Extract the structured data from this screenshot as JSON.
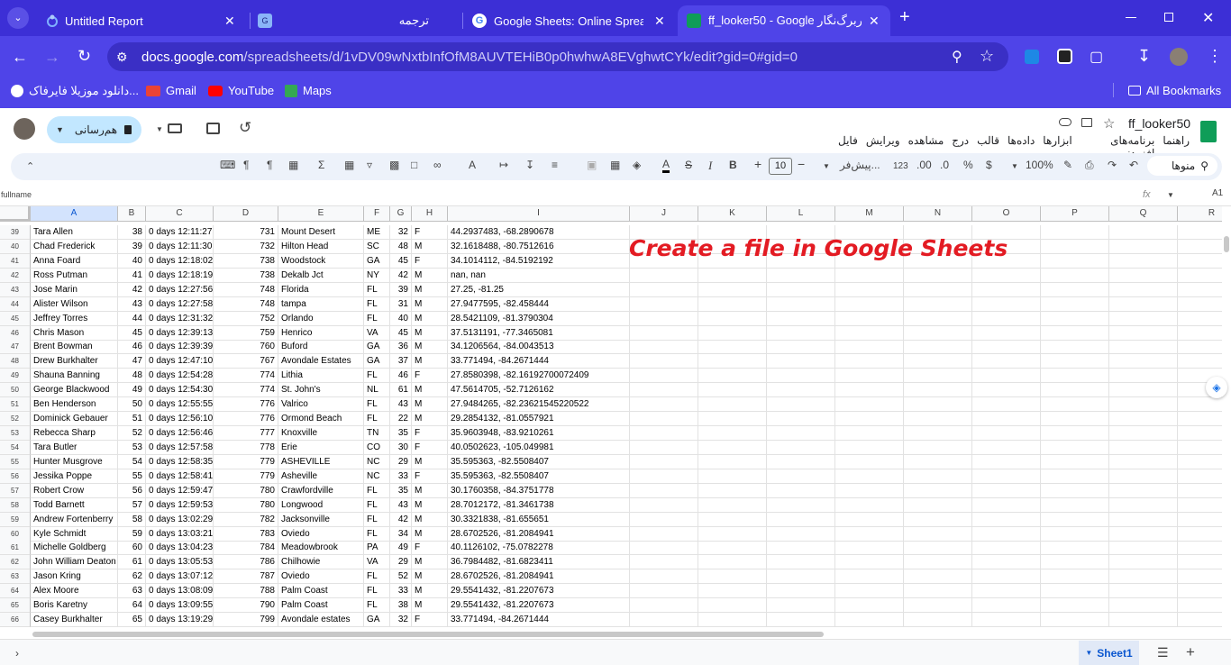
{
  "browser": {
    "tabs": [
      {
        "title": "Untitled Report",
        "active": false
      },
      {
        "title": "ترجمه",
        "active": false
      },
      {
        "title": "Google Sheets: Online Spreadsheets",
        "active": false
      },
      {
        "title": "ff_looker50 - Google کاربرگ‌نگار",
        "active": true
      }
    ],
    "new_tab_symbol": "+",
    "url_host": "docs.google.com",
    "url_path": "/spreadsheets/d/1vDV09wNxtbInfOfM8AUVTEHiB0p0hwhwA8EVghwtCYk/edit?gid=0#gid=0",
    "bookmarks": [
      {
        "label": "دانلود موزیلا فایرفاک...",
        "icon": "mozilla-icon"
      },
      {
        "label": "Gmail",
        "icon": "gmail-icon"
      },
      {
        "label": "YouTube",
        "icon": "youtube-icon"
      },
      {
        "label": "Maps",
        "icon": "maps-icon"
      }
    ],
    "all_bookmarks": "All Bookmarks"
  },
  "sheets": {
    "doc_title": "ff_looker50",
    "share_label": "هم‌رسانی",
    "menus": [
      "فایل",
      "ویرایش",
      "مشاهده",
      "درج",
      "قالب",
      "داده‌ها",
      "ابزارها",
      "برنامه‌های افزودنی",
      "راهنما"
    ],
    "toolbar": {
      "search_menus": "منوها",
      "zoom": "100%",
      "currency": "$",
      "percent": "%",
      "dec_decrease": ".0",
      "dec_increase": ".00",
      "format_123": "123",
      "font": "پیش‌فر...",
      "font_size": "10",
      "minus": "−",
      "plus": "+",
      "bold": "B",
      "italic": "I",
      "strike": "S",
      "text_color": "A",
      "sigma": "Σ"
    },
    "name_box": "A1",
    "formula_value": "fullname",
    "fx": "fx",
    "columns": [
      "A",
      "B",
      "C",
      "D",
      "E",
      "F",
      "G",
      "H",
      "I",
      "J",
      "K",
      "L",
      "M",
      "N",
      "O",
      "P",
      "Q",
      "R"
    ],
    "rows": [
      {
        "n": "39",
        "a": "Tara Allen",
        "b": "38",
        "c": "0 days 12:11:27",
        "d": "731",
        "e": "Mount Desert",
        "f": "ME",
        "g": "32",
        "h": "F",
        "i": "44.2937483, -68.2890678"
      },
      {
        "n": "40",
        "a": "Chad Frederick",
        "b": "39",
        "c": "0 days 12:11:30",
        "d": "732",
        "e": "Hilton Head",
        "f": "SC",
        "g": "48",
        "h": "M",
        "i": "32.1618488, -80.7512616"
      },
      {
        "n": "41",
        "a": "Anna Foard",
        "b": "40",
        "c": "0 days 12:18:02",
        "d": "738",
        "e": "Woodstock",
        "f": "GA",
        "g": "45",
        "h": "F",
        "i": "34.1014112, -84.5192192"
      },
      {
        "n": "42",
        "a": "Ross Putman",
        "b": "41",
        "c": "0 days 12:18:19",
        "d": "738",
        "e": "Dekalb Jct",
        "f": "NY",
        "g": "42",
        "h": "M",
        "i": "nan, nan"
      },
      {
        "n": "43",
        "a": "Jose Marin",
        "b": "42",
        "c": "0 days 12:27:56",
        "d": "748",
        "e": "Florida",
        "f": "FL",
        "g": "39",
        "h": "M",
        "i": "27.25, -81.25"
      },
      {
        "n": "44",
        "a": "Alister Wilson",
        "b": "43",
        "c": "0 days 12:27:58",
        "d": "748",
        "e": "tampa",
        "f": "FL",
        "g": "31",
        "h": "M",
        "i": "27.9477595, -82.458444"
      },
      {
        "n": "45",
        "a": "Jeffrey Torres",
        "b": "44",
        "c": "0 days 12:31:32",
        "d": "752",
        "e": "Orlando",
        "f": "FL",
        "g": "40",
        "h": "M",
        "i": "28.5421109, -81.3790304"
      },
      {
        "n": "46",
        "a": "Chris Mason",
        "b": "45",
        "c": "0 days 12:39:13",
        "d": "759",
        "e": "Henrico",
        "f": "VA",
        "g": "45",
        "h": "M",
        "i": "37.5131191, -77.3465081"
      },
      {
        "n": "47",
        "a": "Brent Bowman",
        "b": "46",
        "c": "0 days 12:39:39",
        "d": "760",
        "e": "Buford",
        "f": "GA",
        "g": "36",
        "h": "M",
        "i": "34.1206564, -84.0043513"
      },
      {
        "n": "48",
        "a": "Drew Burkhalter",
        "b": "47",
        "c": "0 days 12:47:10",
        "d": "767",
        "e": "Avondale Estates",
        "f": "GA",
        "g": "37",
        "h": "M",
        "i": "33.771494, -84.2671444"
      },
      {
        "n": "49",
        "a": "Shauna Banning",
        "b": "48",
        "c": "0 days 12:54:28",
        "d": "774",
        "e": "Lithia",
        "f": "FL",
        "g": "46",
        "h": "F",
        "i": "27.8580398, -82.16192700072409"
      },
      {
        "n": "50",
        "a": "George Blackwood",
        "b": "49",
        "c": "0 days 12:54:30",
        "d": "774",
        "e": "St. John's",
        "f": "NL",
        "g": "61",
        "h": "M",
        "i": "47.5614705, -52.7126162"
      },
      {
        "n": "51",
        "a": "Ben Henderson",
        "b": "50",
        "c": "0 days 12:55:55",
        "d": "776",
        "e": "Valrico",
        "f": "FL",
        "g": "43",
        "h": "M",
        "i": "27.9484265, -82.23621545220522"
      },
      {
        "n": "52",
        "a": "Dominick Gebauer",
        "b": "51",
        "c": "0 days 12:56:10",
        "d": "776",
        "e": "Ormond Beach",
        "f": "FL",
        "g": "22",
        "h": "M",
        "i": "29.2854132, -81.0557921"
      },
      {
        "n": "53",
        "a": "Rebecca Sharp",
        "b": "52",
        "c": "0 days 12:56:46",
        "d": "777",
        "e": "Knoxville",
        "f": "TN",
        "g": "35",
        "h": "F",
        "i": "35.9603948, -83.9210261"
      },
      {
        "n": "54",
        "a": "Tara Butler",
        "b": "53",
        "c": "0 days 12:57:58",
        "d": "778",
        "e": "Erie",
        "f": "CO",
        "g": "30",
        "h": "F",
        "i": "40.0502623, -105.049981"
      },
      {
        "n": "55",
        "a": "Hunter Musgrove",
        "b": "54",
        "c": "0 days 12:58:35",
        "d": "779",
        "e": "ASHEVILLE",
        "f": "NC",
        "g": "29",
        "h": "M",
        "i": "35.595363, -82.5508407"
      },
      {
        "n": "56",
        "a": "Jessika Poppe",
        "b": "55",
        "c": "0 days 12:58:41",
        "d": "779",
        "e": "Asheville",
        "f": "NC",
        "g": "33",
        "h": "F",
        "i": "35.595363, -82.5508407"
      },
      {
        "n": "57",
        "a": "Robert Crow",
        "b": "56",
        "c": "0 days 12:59:47",
        "d": "780",
        "e": "Crawfordville",
        "f": "FL",
        "g": "35",
        "h": "M",
        "i": "30.1760358, -84.3751778"
      },
      {
        "n": "58",
        "a": "Todd Barnett",
        "b": "57",
        "c": "0 days 12:59:53",
        "d": "780",
        "e": "Longwood",
        "f": "FL",
        "g": "43",
        "h": "M",
        "i": "28.7012172, -81.3461738"
      },
      {
        "n": "59",
        "a": "Andrew Fortenberry",
        "b": "58",
        "c": "0 days 13:02:29",
        "d": "782",
        "e": "Jacksonville",
        "f": "FL",
        "g": "42",
        "h": "M",
        "i": "30.3321838, -81.655651"
      },
      {
        "n": "60",
        "a": "Kyle Schmidt",
        "b": "59",
        "c": "0 days 13:03:21",
        "d": "783",
        "e": "Oviedo",
        "f": "FL",
        "g": "34",
        "h": "M",
        "i": "28.6702526, -81.2084941"
      },
      {
        "n": "61",
        "a": "Michelle Goldberg",
        "b": "60",
        "c": "0 days 13:04:23",
        "d": "784",
        "e": "Meadowbrook",
        "f": "PA",
        "g": "49",
        "h": "F",
        "i": "40.1126102, -75.0782278"
      },
      {
        "n": "62",
        "a": "John William Deaton",
        "b": "61",
        "c": "0 days 13:05:53",
        "d": "786",
        "e": "Chilhowie",
        "f": "VA",
        "g": "29",
        "h": "M",
        "i": "36.7984482, -81.6823411"
      },
      {
        "n": "63",
        "a": "Jason Kring",
        "b": "62",
        "c": "0 days 13:07:12",
        "d": "787",
        "e": "Oviedo",
        "f": "FL",
        "g": "52",
        "h": "M",
        "i": "28.6702526, -81.2084941"
      },
      {
        "n": "64",
        "a": "Alex Moore",
        "b": "63",
        "c": "0 days 13:08:09",
        "d": "788",
        "e": "Palm Coast",
        "f": "FL",
        "g": "33",
        "h": "M",
        "i": "29.5541432, -81.2207673"
      },
      {
        "n": "65",
        "a": "Boris Karetny",
        "b": "64",
        "c": "0 days 13:09:55",
        "d": "790",
        "e": "Palm Coast",
        "f": "FL",
        "g": "38",
        "h": "M",
        "i": "29.5541432, -81.2207673"
      },
      {
        "n": "66",
        "a": "Casey Burkhalter",
        "b": "65",
        "c": "0 days 13:19:29",
        "d": "799",
        "e": "Avondale estates",
        "f": "GA",
        "g": "32",
        "h": "F",
        "i": "33.771494, -84.2671444"
      }
    ],
    "overlay_caption": "Create a file in Google Sheets",
    "sheet_tab": "Sheet1"
  }
}
